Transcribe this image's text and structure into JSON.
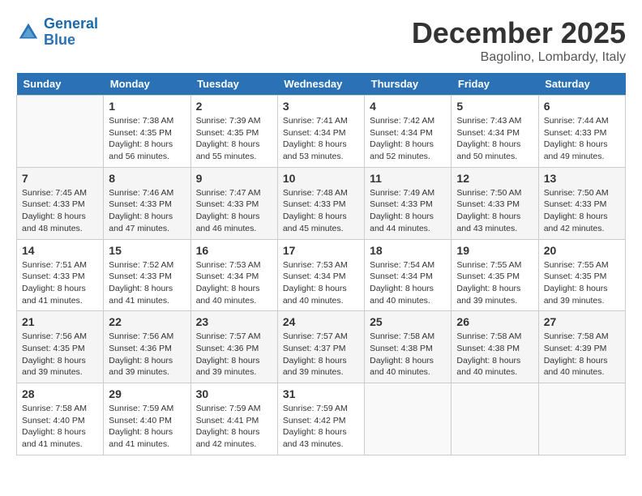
{
  "logo": {
    "line1": "General",
    "line2": "Blue"
  },
  "title": "December 2025",
  "location": "Bagolino, Lombardy, Italy",
  "weekdays": [
    "Sunday",
    "Monday",
    "Tuesday",
    "Wednesday",
    "Thursday",
    "Friday",
    "Saturday"
  ],
  "weeks": [
    [
      {
        "day": "",
        "info": ""
      },
      {
        "day": "1",
        "info": "Sunrise: 7:38 AM\nSunset: 4:35 PM\nDaylight: 8 hours\nand 56 minutes."
      },
      {
        "day": "2",
        "info": "Sunrise: 7:39 AM\nSunset: 4:35 PM\nDaylight: 8 hours\nand 55 minutes."
      },
      {
        "day": "3",
        "info": "Sunrise: 7:41 AM\nSunset: 4:34 PM\nDaylight: 8 hours\nand 53 minutes."
      },
      {
        "day": "4",
        "info": "Sunrise: 7:42 AM\nSunset: 4:34 PM\nDaylight: 8 hours\nand 52 minutes."
      },
      {
        "day": "5",
        "info": "Sunrise: 7:43 AM\nSunset: 4:34 PM\nDaylight: 8 hours\nand 50 minutes."
      },
      {
        "day": "6",
        "info": "Sunrise: 7:44 AM\nSunset: 4:33 PM\nDaylight: 8 hours\nand 49 minutes."
      }
    ],
    [
      {
        "day": "7",
        "info": "Sunrise: 7:45 AM\nSunset: 4:33 PM\nDaylight: 8 hours\nand 48 minutes."
      },
      {
        "day": "8",
        "info": "Sunrise: 7:46 AM\nSunset: 4:33 PM\nDaylight: 8 hours\nand 47 minutes."
      },
      {
        "day": "9",
        "info": "Sunrise: 7:47 AM\nSunset: 4:33 PM\nDaylight: 8 hours\nand 46 minutes."
      },
      {
        "day": "10",
        "info": "Sunrise: 7:48 AM\nSunset: 4:33 PM\nDaylight: 8 hours\nand 45 minutes."
      },
      {
        "day": "11",
        "info": "Sunrise: 7:49 AM\nSunset: 4:33 PM\nDaylight: 8 hours\nand 44 minutes."
      },
      {
        "day": "12",
        "info": "Sunrise: 7:50 AM\nSunset: 4:33 PM\nDaylight: 8 hours\nand 43 minutes."
      },
      {
        "day": "13",
        "info": "Sunrise: 7:50 AM\nSunset: 4:33 PM\nDaylight: 8 hours\nand 42 minutes."
      }
    ],
    [
      {
        "day": "14",
        "info": "Sunrise: 7:51 AM\nSunset: 4:33 PM\nDaylight: 8 hours\nand 41 minutes."
      },
      {
        "day": "15",
        "info": "Sunrise: 7:52 AM\nSunset: 4:33 PM\nDaylight: 8 hours\nand 41 minutes."
      },
      {
        "day": "16",
        "info": "Sunrise: 7:53 AM\nSunset: 4:34 PM\nDaylight: 8 hours\nand 40 minutes."
      },
      {
        "day": "17",
        "info": "Sunrise: 7:53 AM\nSunset: 4:34 PM\nDaylight: 8 hours\nand 40 minutes."
      },
      {
        "day": "18",
        "info": "Sunrise: 7:54 AM\nSunset: 4:34 PM\nDaylight: 8 hours\nand 40 minutes."
      },
      {
        "day": "19",
        "info": "Sunrise: 7:55 AM\nSunset: 4:35 PM\nDaylight: 8 hours\nand 39 minutes."
      },
      {
        "day": "20",
        "info": "Sunrise: 7:55 AM\nSunset: 4:35 PM\nDaylight: 8 hours\nand 39 minutes."
      }
    ],
    [
      {
        "day": "21",
        "info": "Sunrise: 7:56 AM\nSunset: 4:35 PM\nDaylight: 8 hours\nand 39 minutes."
      },
      {
        "day": "22",
        "info": "Sunrise: 7:56 AM\nSunset: 4:36 PM\nDaylight: 8 hours\nand 39 minutes."
      },
      {
        "day": "23",
        "info": "Sunrise: 7:57 AM\nSunset: 4:36 PM\nDaylight: 8 hours\nand 39 minutes."
      },
      {
        "day": "24",
        "info": "Sunrise: 7:57 AM\nSunset: 4:37 PM\nDaylight: 8 hours\nand 39 minutes."
      },
      {
        "day": "25",
        "info": "Sunrise: 7:58 AM\nSunset: 4:38 PM\nDaylight: 8 hours\nand 40 minutes."
      },
      {
        "day": "26",
        "info": "Sunrise: 7:58 AM\nSunset: 4:38 PM\nDaylight: 8 hours\nand 40 minutes."
      },
      {
        "day": "27",
        "info": "Sunrise: 7:58 AM\nSunset: 4:39 PM\nDaylight: 8 hours\nand 40 minutes."
      }
    ],
    [
      {
        "day": "28",
        "info": "Sunrise: 7:58 AM\nSunset: 4:40 PM\nDaylight: 8 hours\nand 41 minutes."
      },
      {
        "day": "29",
        "info": "Sunrise: 7:59 AM\nSunset: 4:40 PM\nDaylight: 8 hours\nand 41 minutes."
      },
      {
        "day": "30",
        "info": "Sunrise: 7:59 AM\nSunset: 4:41 PM\nDaylight: 8 hours\nand 42 minutes."
      },
      {
        "day": "31",
        "info": "Sunrise: 7:59 AM\nSunset: 4:42 PM\nDaylight: 8 hours\nand 43 minutes."
      },
      {
        "day": "",
        "info": ""
      },
      {
        "day": "",
        "info": ""
      },
      {
        "day": "",
        "info": ""
      }
    ]
  ]
}
